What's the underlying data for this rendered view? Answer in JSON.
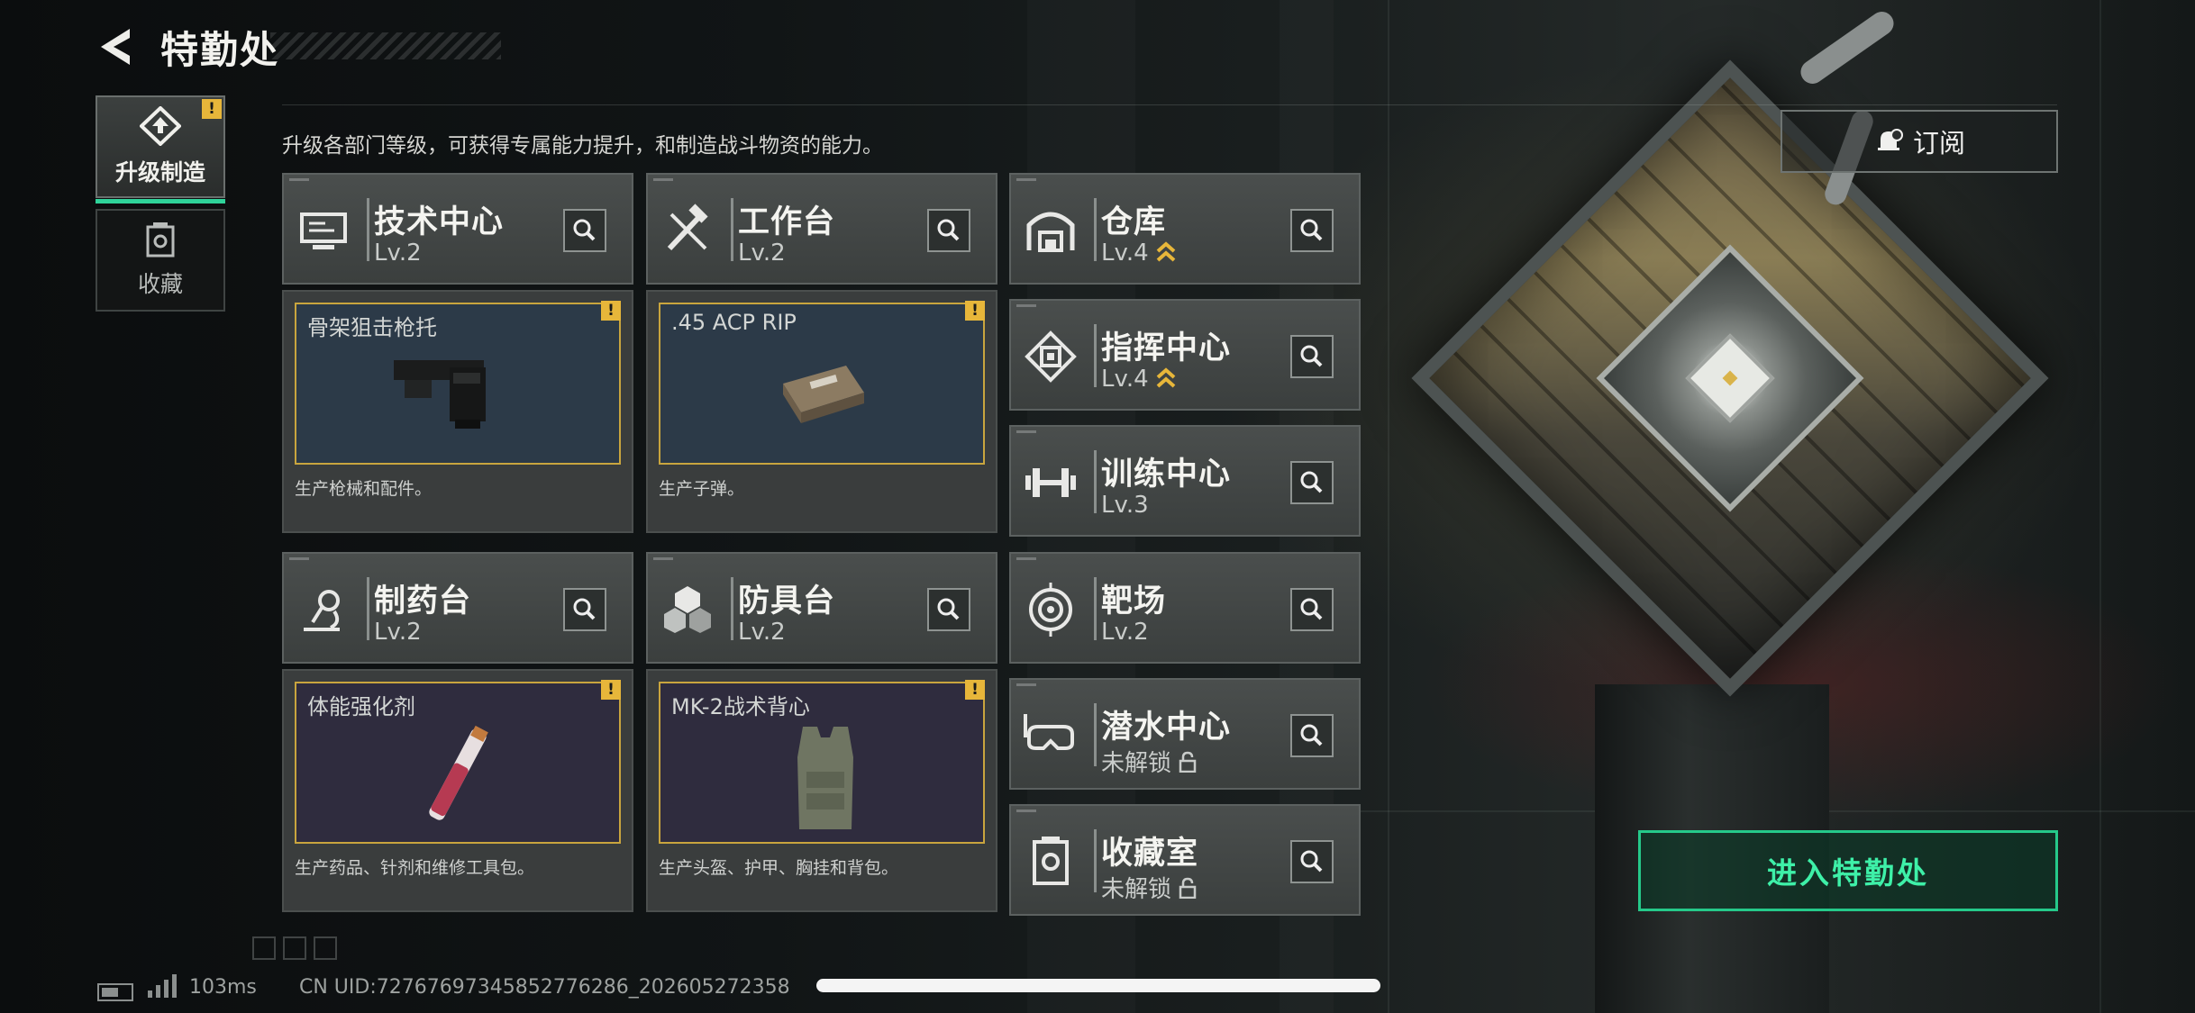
{
  "header": {
    "title": "特勤处",
    "description": "升级各部门等级，可获得专属能力提升，和制造战斗物资的能力。"
  },
  "tabs": [
    {
      "label": "升级制造",
      "active": true,
      "icon": "upgrade-icon",
      "warning": "!"
    },
    {
      "label": "收藏",
      "active": false,
      "icon": "collection-icon"
    }
  ],
  "departments": {
    "tech_center": {
      "name": "技术中心",
      "level": "Lv.2",
      "icon": "monitor-icon"
    },
    "workbench": {
      "name": "工作台",
      "level": "Lv.2",
      "icon": "tools-icon"
    },
    "pharmacy": {
      "name": "制药台",
      "level": "Lv.2",
      "icon": "microscope-icon"
    },
    "armor_bench": {
      "name": "防具台",
      "level": "Lv.2",
      "icon": "cubes-icon"
    },
    "warehouse": {
      "name": "仓库",
      "level": "Lv.4",
      "icon": "warehouse-icon",
      "rank": true
    },
    "command_center": {
      "name": "指挥中心",
      "level": "Lv.4",
      "icon": "chip-icon",
      "rank": true
    },
    "training_center": {
      "name": "训练中心",
      "level": "Lv.3",
      "icon": "dumbbell-icon"
    },
    "shooting_range": {
      "name": "靶场",
      "level": "Lv.2",
      "icon": "target-icon"
    },
    "diving_center": {
      "name": "潜水中心",
      "level": "未解锁",
      "icon": "diving-mask-icon",
      "locked": true
    },
    "collection_room": {
      "name": "收藏室",
      "level": "未解锁",
      "icon": "trophy-icon",
      "locked": true
    }
  },
  "production": {
    "tech_center": {
      "item": "骨架狙击枪托",
      "desc": "生产枪械和配件。",
      "warning": "!"
    },
    "workbench": {
      "item": ".45 ACP RIP",
      "desc": "生产子弹。",
      "warning": "!"
    },
    "pharmacy": {
      "item": "体能强化剂",
      "desc": "生产药品、针剂和维修工具包。",
      "warning": "!"
    },
    "armor_bench": {
      "item": "MK-2战术背心",
      "desc": "生产头盔、护甲、胸挂和背包。",
      "warning": "!"
    }
  },
  "actions": {
    "subscribe": "订阅",
    "enter": "进入特勤处"
  },
  "footer": {
    "ping": "103ms",
    "uid": "CN UID:7276769734585​2776286_202605272358"
  },
  "colors": {
    "accent": "#2fd39a",
    "warning": "#e7b63a",
    "rank": "#e7b63a"
  }
}
